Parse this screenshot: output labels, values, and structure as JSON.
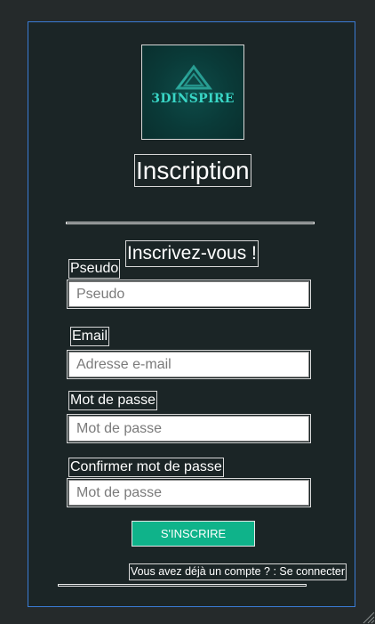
{
  "logo": {
    "text": "3DINSPIRE",
    "accent": "#39d6c6"
  },
  "title": "Inscription",
  "subtitle": "Inscrivez-vous !",
  "fields": {
    "pseudo": {
      "label": "Pseudo",
      "placeholder": "Pseudo"
    },
    "email": {
      "label": "Email",
      "placeholder": "Adresse e-mail"
    },
    "password": {
      "label": "Mot de passe",
      "placeholder": "Mot de passe"
    },
    "confirm": {
      "label": "Confirmer mot de passe",
      "placeholder": "Mot de passe"
    }
  },
  "submit_label": "S'INSCRIRE",
  "login_link": "Vous avez déjà un compte ? : Se connecter",
  "colors": {
    "background": "#252a2b",
    "card": "#1b2526",
    "card_border": "#3a7bd5",
    "button": "#0fb38a"
  }
}
